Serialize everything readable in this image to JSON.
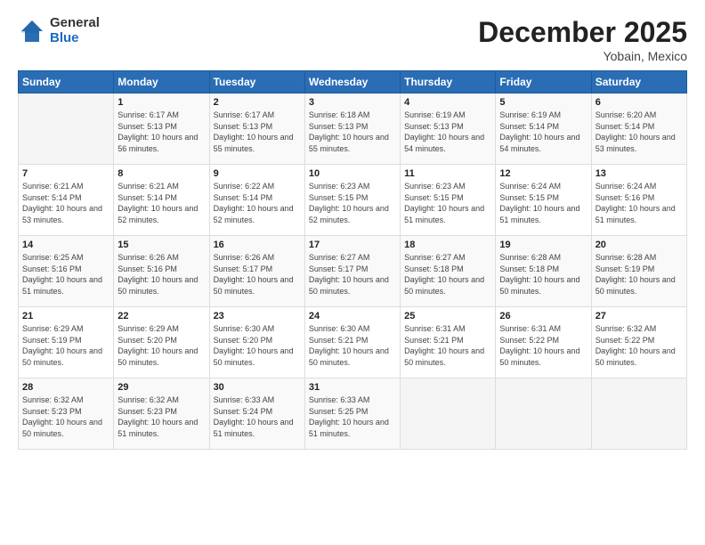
{
  "logo": {
    "general": "General",
    "blue": "Blue"
  },
  "title": "December 2025",
  "location": "Yobain, Mexico",
  "days_of_week": [
    "Sunday",
    "Monday",
    "Tuesday",
    "Wednesday",
    "Thursday",
    "Friday",
    "Saturday"
  ],
  "weeks": [
    [
      {
        "day": "",
        "sunrise": "",
        "sunset": "",
        "daylight": ""
      },
      {
        "day": "1",
        "sunrise": "Sunrise: 6:17 AM",
        "sunset": "Sunset: 5:13 PM",
        "daylight": "Daylight: 10 hours and 56 minutes."
      },
      {
        "day": "2",
        "sunrise": "Sunrise: 6:17 AM",
        "sunset": "Sunset: 5:13 PM",
        "daylight": "Daylight: 10 hours and 55 minutes."
      },
      {
        "day": "3",
        "sunrise": "Sunrise: 6:18 AM",
        "sunset": "Sunset: 5:13 PM",
        "daylight": "Daylight: 10 hours and 55 minutes."
      },
      {
        "day": "4",
        "sunrise": "Sunrise: 6:19 AM",
        "sunset": "Sunset: 5:13 PM",
        "daylight": "Daylight: 10 hours and 54 minutes."
      },
      {
        "day": "5",
        "sunrise": "Sunrise: 6:19 AM",
        "sunset": "Sunset: 5:14 PM",
        "daylight": "Daylight: 10 hours and 54 minutes."
      },
      {
        "day": "6",
        "sunrise": "Sunrise: 6:20 AM",
        "sunset": "Sunset: 5:14 PM",
        "daylight": "Daylight: 10 hours and 53 minutes."
      }
    ],
    [
      {
        "day": "7",
        "sunrise": "Sunrise: 6:21 AM",
        "sunset": "Sunset: 5:14 PM",
        "daylight": "Daylight: 10 hours and 53 minutes."
      },
      {
        "day": "8",
        "sunrise": "Sunrise: 6:21 AM",
        "sunset": "Sunset: 5:14 PM",
        "daylight": "Daylight: 10 hours and 52 minutes."
      },
      {
        "day": "9",
        "sunrise": "Sunrise: 6:22 AM",
        "sunset": "Sunset: 5:14 PM",
        "daylight": "Daylight: 10 hours and 52 minutes."
      },
      {
        "day": "10",
        "sunrise": "Sunrise: 6:23 AM",
        "sunset": "Sunset: 5:15 PM",
        "daylight": "Daylight: 10 hours and 52 minutes."
      },
      {
        "day": "11",
        "sunrise": "Sunrise: 6:23 AM",
        "sunset": "Sunset: 5:15 PM",
        "daylight": "Daylight: 10 hours and 51 minutes."
      },
      {
        "day": "12",
        "sunrise": "Sunrise: 6:24 AM",
        "sunset": "Sunset: 5:15 PM",
        "daylight": "Daylight: 10 hours and 51 minutes."
      },
      {
        "day": "13",
        "sunrise": "Sunrise: 6:24 AM",
        "sunset": "Sunset: 5:16 PM",
        "daylight": "Daylight: 10 hours and 51 minutes."
      }
    ],
    [
      {
        "day": "14",
        "sunrise": "Sunrise: 6:25 AM",
        "sunset": "Sunset: 5:16 PM",
        "daylight": "Daylight: 10 hours and 51 minutes."
      },
      {
        "day": "15",
        "sunrise": "Sunrise: 6:26 AM",
        "sunset": "Sunset: 5:16 PM",
        "daylight": "Daylight: 10 hours and 50 minutes."
      },
      {
        "day": "16",
        "sunrise": "Sunrise: 6:26 AM",
        "sunset": "Sunset: 5:17 PM",
        "daylight": "Daylight: 10 hours and 50 minutes."
      },
      {
        "day": "17",
        "sunrise": "Sunrise: 6:27 AM",
        "sunset": "Sunset: 5:17 PM",
        "daylight": "Daylight: 10 hours and 50 minutes."
      },
      {
        "day": "18",
        "sunrise": "Sunrise: 6:27 AM",
        "sunset": "Sunset: 5:18 PM",
        "daylight": "Daylight: 10 hours and 50 minutes."
      },
      {
        "day": "19",
        "sunrise": "Sunrise: 6:28 AM",
        "sunset": "Sunset: 5:18 PM",
        "daylight": "Daylight: 10 hours and 50 minutes."
      },
      {
        "day": "20",
        "sunrise": "Sunrise: 6:28 AM",
        "sunset": "Sunset: 5:19 PM",
        "daylight": "Daylight: 10 hours and 50 minutes."
      }
    ],
    [
      {
        "day": "21",
        "sunrise": "Sunrise: 6:29 AM",
        "sunset": "Sunset: 5:19 PM",
        "daylight": "Daylight: 10 hours and 50 minutes."
      },
      {
        "day": "22",
        "sunrise": "Sunrise: 6:29 AM",
        "sunset": "Sunset: 5:20 PM",
        "daylight": "Daylight: 10 hours and 50 minutes."
      },
      {
        "day": "23",
        "sunrise": "Sunrise: 6:30 AM",
        "sunset": "Sunset: 5:20 PM",
        "daylight": "Daylight: 10 hours and 50 minutes."
      },
      {
        "day": "24",
        "sunrise": "Sunrise: 6:30 AM",
        "sunset": "Sunset: 5:21 PM",
        "daylight": "Daylight: 10 hours and 50 minutes."
      },
      {
        "day": "25",
        "sunrise": "Sunrise: 6:31 AM",
        "sunset": "Sunset: 5:21 PM",
        "daylight": "Daylight: 10 hours and 50 minutes."
      },
      {
        "day": "26",
        "sunrise": "Sunrise: 6:31 AM",
        "sunset": "Sunset: 5:22 PM",
        "daylight": "Daylight: 10 hours and 50 minutes."
      },
      {
        "day": "27",
        "sunrise": "Sunrise: 6:32 AM",
        "sunset": "Sunset: 5:22 PM",
        "daylight": "Daylight: 10 hours and 50 minutes."
      }
    ],
    [
      {
        "day": "28",
        "sunrise": "Sunrise: 6:32 AM",
        "sunset": "Sunset: 5:23 PM",
        "daylight": "Daylight: 10 hours and 50 minutes."
      },
      {
        "day": "29",
        "sunrise": "Sunrise: 6:32 AM",
        "sunset": "Sunset: 5:23 PM",
        "daylight": "Daylight: 10 hours and 51 minutes."
      },
      {
        "day": "30",
        "sunrise": "Sunrise: 6:33 AM",
        "sunset": "Sunset: 5:24 PM",
        "daylight": "Daylight: 10 hours and 51 minutes."
      },
      {
        "day": "31",
        "sunrise": "Sunrise: 6:33 AM",
        "sunset": "Sunset: 5:25 PM",
        "daylight": "Daylight: 10 hours and 51 minutes."
      },
      {
        "day": "",
        "sunrise": "",
        "sunset": "",
        "daylight": ""
      },
      {
        "day": "",
        "sunrise": "",
        "sunset": "",
        "daylight": ""
      },
      {
        "day": "",
        "sunrise": "",
        "sunset": "",
        "daylight": ""
      }
    ]
  ]
}
